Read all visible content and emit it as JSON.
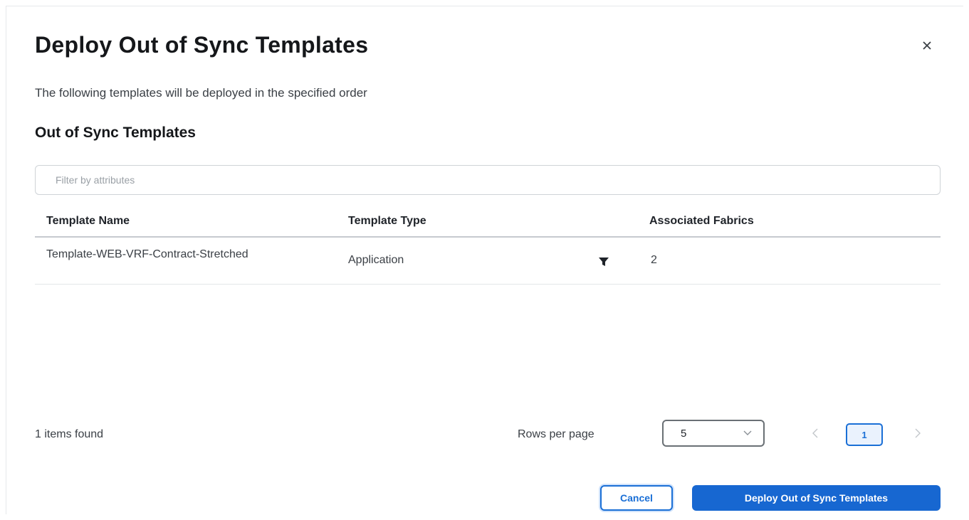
{
  "dialog": {
    "title": "Deploy Out of Sync Templates",
    "subtitle": "The following templates will be deployed in the specified order",
    "section_title": "Out of Sync Templates",
    "close_icon": "close-icon"
  },
  "filter": {
    "placeholder": "Filter by attributes",
    "value": ""
  },
  "table": {
    "columns": [
      "Template Name",
      "Template Type",
      "Associated Fabrics"
    ],
    "rows": [
      {
        "name": "Template-WEB-VRF-Contract-Stretched",
        "type": "Application",
        "fabrics": "2",
        "filter_icon": "filter-icon"
      }
    ]
  },
  "footer": {
    "items_found": "1 items found",
    "rows_per_page_label": "Rows per page",
    "rows_per_page_value": "5",
    "current_page": "1",
    "prev_icon": "chevron-left-icon",
    "next_icon": "chevron-right-icon"
  },
  "actions": {
    "cancel_label": "Cancel",
    "deploy_label": "Deploy Out of Sync Templates"
  },
  "colors": {
    "primary": "#1767d1",
    "text": "#1f2329",
    "muted": "#9aa0a6"
  }
}
